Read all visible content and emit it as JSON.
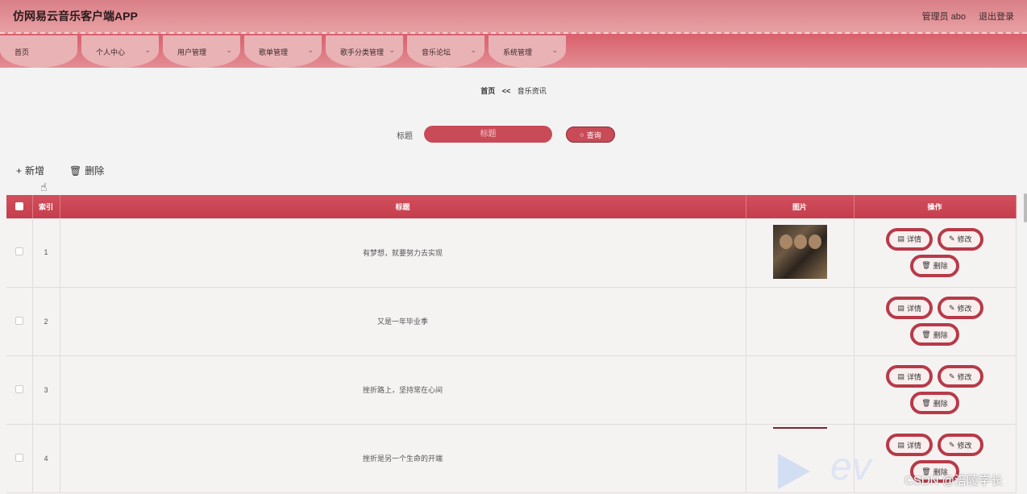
{
  "header": {
    "title": "仿网易云音乐客户端APP",
    "user": "管理员 abo",
    "logout": "退出登录"
  },
  "nav": [
    {
      "label": "首页",
      "has_dropdown": false
    },
    {
      "label": "个人中心",
      "has_dropdown": true
    },
    {
      "label": "用户管理",
      "has_dropdown": true
    },
    {
      "label": "歌单管理",
      "has_dropdown": true
    },
    {
      "label": "歌手分类管理",
      "has_dropdown": true
    },
    {
      "label": "音乐论坛",
      "has_dropdown": true
    },
    {
      "label": "系统管理",
      "has_dropdown": true
    }
  ],
  "breadcrumb": {
    "home": "首页",
    "separator": "<<",
    "current": "音乐资讯"
  },
  "search": {
    "label": "标题",
    "placeholder": "标题",
    "button": "查询"
  },
  "toolbar": {
    "add": "新增",
    "delete": "删除"
  },
  "table": {
    "headers": {
      "index": "索引",
      "title": "标题",
      "image": "图片",
      "actions": "操作"
    },
    "rows": [
      {
        "index": "1",
        "title": "有梦想，就要努力去实现",
        "image": "poster"
      },
      {
        "index": "2",
        "title": "又是一年毕业季",
        "image": ""
      },
      {
        "index": "3",
        "title": "挫折路上，坚持常在心间",
        "image": ""
      },
      {
        "index": "4",
        "title": "挫折是另一个生命的开端",
        "image": "partial"
      }
    ],
    "action_labels": {
      "detail": "详情",
      "edit": "修改",
      "delete": "删除"
    }
  },
  "watermark": {
    "text": "ev",
    "csdn": "CSDN @涪陵学长"
  },
  "colors": {
    "accent": "#c94b58",
    "header": "#e8a1a4",
    "border": "#b73a48"
  }
}
